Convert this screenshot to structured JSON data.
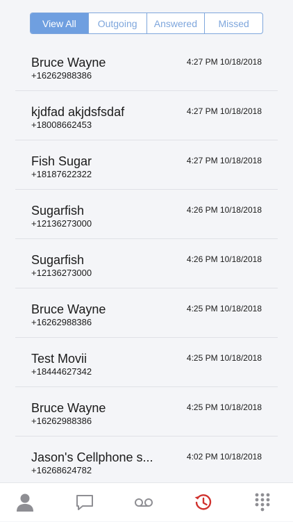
{
  "filter_tabs": [
    {
      "label": "View All",
      "active": true
    },
    {
      "label": "Outgoing",
      "active": false
    },
    {
      "label": "Answered",
      "active": false
    },
    {
      "label": "Missed",
      "active": false
    }
  ],
  "calls": [
    {
      "name": "Bruce Wayne",
      "number": "+16262988386",
      "time": "4:27 PM 10/18/2018"
    },
    {
      "name": "kjdfad akjdsfsdaf",
      "number": "+18008662453",
      "time": "4:27 PM 10/18/2018"
    },
    {
      "name": "Fish Sugar",
      "number": "+18187622322",
      "time": "4:27 PM 10/18/2018"
    },
    {
      "name": "Sugarfish",
      "number": "+12136273000",
      "time": "4:26 PM 10/18/2018"
    },
    {
      "name": "Sugarfish",
      "number": "+12136273000",
      "time": "4:26 PM 10/18/2018"
    },
    {
      "name": "Bruce Wayne",
      "number": "+16262988386",
      "time": "4:25 PM 10/18/2018"
    },
    {
      "name": "Test Movii",
      "number": "+18444627342",
      "time": "4:25 PM 10/18/2018"
    },
    {
      "name": "Bruce Wayne",
      "number": "+16262988386",
      "time": "4:25 PM 10/18/2018"
    },
    {
      "name": "Jason's Cellphone s...",
      "number": "+16268624782",
      "time": "4:02 PM 10/18/2018"
    }
  ],
  "tab_bar": {
    "items": [
      {
        "icon": "contacts-icon",
        "active": false
      },
      {
        "icon": "messages-icon",
        "active": false
      },
      {
        "icon": "voicemail-icon",
        "active": false
      },
      {
        "icon": "recents-icon",
        "active": true
      },
      {
        "icon": "keypad-icon",
        "active": false
      }
    ]
  },
  "colors": {
    "accent": "#6f9fe0",
    "active_tab": "#d0322e",
    "inactive_tab": "#8e8e93",
    "background": "#f4f5f8"
  }
}
